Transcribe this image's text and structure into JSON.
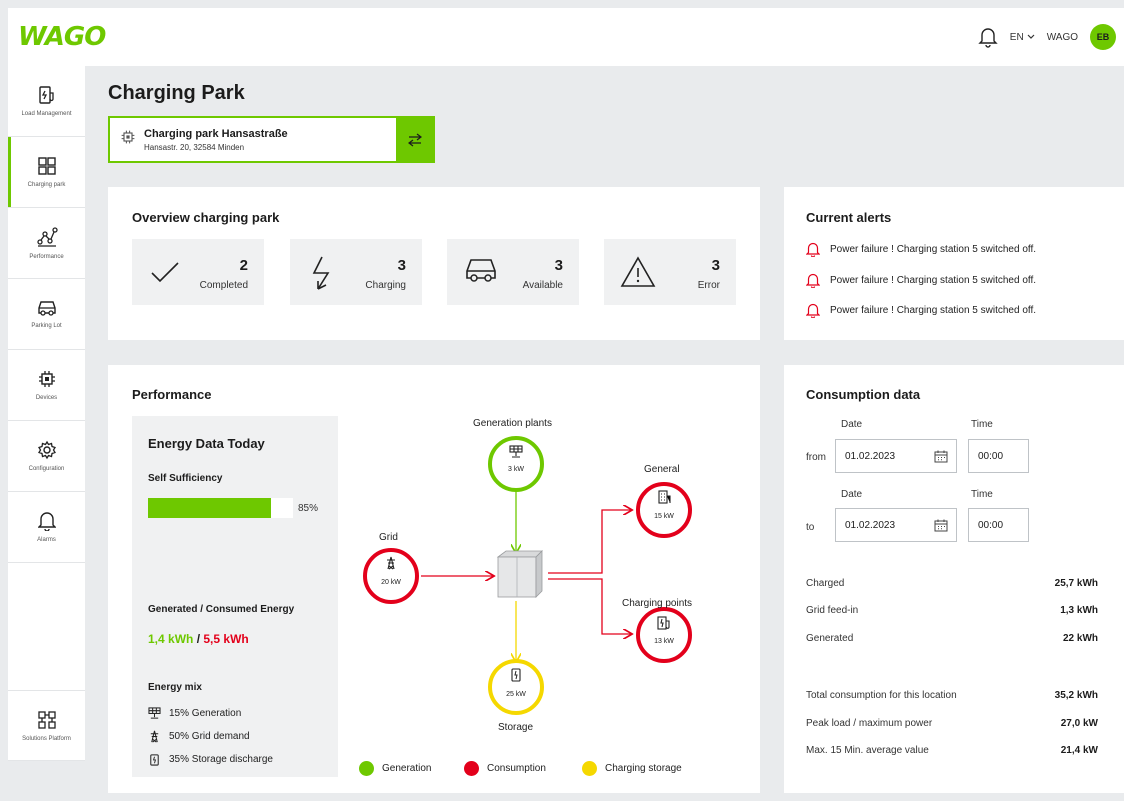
{
  "header": {
    "logo_text": "WAGO",
    "language": "EN",
    "user_name": "WAGO",
    "avatar_initials": "EB",
    "accent_color": "#6ec800"
  },
  "sidebar": {
    "items": [
      {
        "label": "Load Management",
        "icon": "plug-lightning-icon",
        "active": false
      },
      {
        "label": "Charging park",
        "icon": "grid-icon",
        "active": true
      },
      {
        "label": "Performance",
        "icon": "performance-icon",
        "active": false
      },
      {
        "label": "Parking Lot",
        "icon": "car-icon",
        "active": false
      },
      {
        "label": "Devices",
        "icon": "chip-icon",
        "active": false
      },
      {
        "label": "Configuration",
        "icon": "gear-icon",
        "active": false
      },
      {
        "label": "Alarms",
        "icon": "bell-icon",
        "active": false
      }
    ],
    "bottom_item": {
      "label": "Solutions Platform",
      "icon": "network-icon"
    }
  },
  "page": {
    "title": "Charging Park",
    "park_name": "Charging park Hansastraße",
    "park_address": "Hansastr. 20, 32584 Minden"
  },
  "overview": {
    "title": "Overview charging park",
    "stats": [
      {
        "value": "2",
        "label": "Completed",
        "icon": "check-icon"
      },
      {
        "value": "3",
        "label": "Charging",
        "icon": "lightning-icon"
      },
      {
        "value": "3",
        "label": "Available",
        "icon": "car-icon"
      },
      {
        "value": "3",
        "label": "Error",
        "icon": "warning-icon"
      }
    ]
  },
  "alerts": {
    "title": "Current alerts",
    "items": [
      "Power failure ! Charging station 5 switched off.",
      "Power failure ! Charging station 5 switched off.",
      "Power failure ! Charging station 5 switched off."
    ]
  },
  "performance": {
    "title": "Performance",
    "energy_title": "Energy Data Today",
    "self_sufficiency_label": "Self Sufficiency",
    "self_sufficiency_percent": 85,
    "self_sufficiency_text": "85%",
    "gen_cons_label": "Generated / Consumed Energy",
    "generated_value": "1,4 kWh",
    "separator": " / ",
    "consumed_value": "5,5 kWh",
    "mix_title": "Energy mix",
    "mix": [
      {
        "text": "15% Generation",
        "icon": "solar-icon"
      },
      {
        "text": "50% Grid demand",
        "icon": "pylon-icon"
      },
      {
        "text": "35% Storage discharge",
        "icon": "battery-icon"
      }
    ],
    "nodes": {
      "generation": {
        "label": "Generation plants",
        "kw": "3 kW"
      },
      "grid": {
        "label": "Grid",
        "kw": "20 kW"
      },
      "general": {
        "label": "General",
        "kw": "15 kW"
      },
      "charging_points": {
        "label": "Charging points",
        "kw": "13 kW"
      },
      "storage": {
        "label": "Storage",
        "kw": "25 kW"
      }
    },
    "legend": [
      {
        "label": "Generation",
        "color": "#6ec800"
      },
      {
        "label": "Consumption",
        "color": "#e3001b"
      },
      {
        "label": "Charging storage",
        "color": "#f5d800"
      }
    ]
  },
  "consumption": {
    "title": "Consumption data",
    "date_label": "Date",
    "time_label": "Time",
    "from_label": "from",
    "to_label": "to",
    "from_date": "01.02.2023",
    "from_time": "00:00",
    "to_date": "01.02.2023",
    "to_time": "00:00",
    "rows": [
      {
        "label": "Charged",
        "value": "25,7 kWh"
      },
      {
        "label": "Grid feed-in",
        "value": "1,3 kWh"
      },
      {
        "label": "Generated",
        "value": "22 kWh"
      }
    ],
    "rows2": [
      {
        "label": "Total consumption for this location",
        "value": "35,2 kWh"
      },
      {
        "label": "Peak load / maximum power",
        "value": "27,0 kW"
      },
      {
        "label": "Max. 15 Min. average value",
        "value": "21,4 kW"
      }
    ]
  }
}
